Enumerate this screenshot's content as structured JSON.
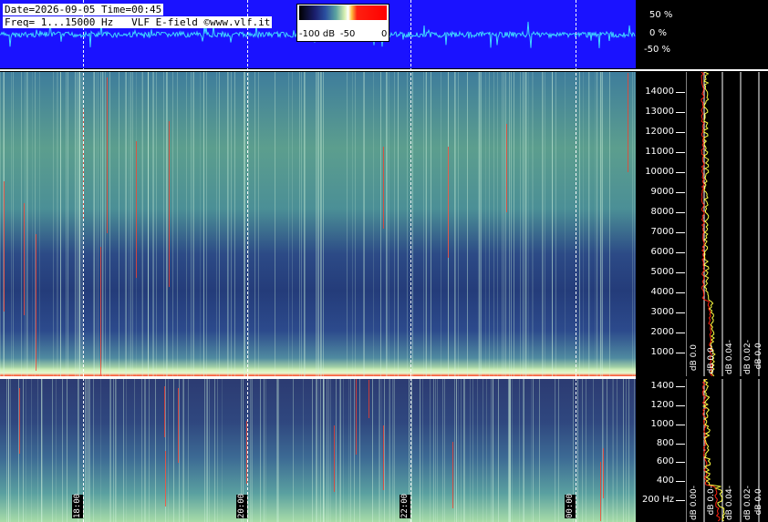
{
  "header": {
    "date_line": "Date=2026-09-05 Time=00:45",
    "freq_line": "Freq= 1...15000 Hz   VLF E-field ©www.vlf.it"
  },
  "colorbar": {
    "label_min": "-100 dB",
    "label_mid": "-50",
    "label_max": "0"
  },
  "amplitude_scale": [
    "50 %",
    "0 %",
    "-50 %"
  ],
  "freq_scale_high": [
    "14000",
    "13000",
    "12000",
    "11000",
    "10000",
    "9000",
    "8000",
    "7000",
    "6000",
    "5000",
    "4000",
    "3000",
    "2000",
    "1000"
  ],
  "freq_scale_low": [
    "1400",
    "1200",
    "1000",
    "800",
    "600",
    "400",
    "200 Hz"
  ],
  "time_labels": [
    "18:00",
    "20:00",
    "22:00",
    "00:00"
  ],
  "spectrum_db_labels_high": [
    "dB 0.0",
    "dB 0.0-",
    "dB 0.04-",
    "dB 0.02-",
    "dB 0.0-"
  ],
  "spectrum_db_labels_low": [
    "dB 0.00-",
    "dB 0.0-",
    "dB 0.04-",
    "dB 0.02-",
    "dB 0.0-"
  ],
  "colors": {
    "waveform_bg": "#1a12ff",
    "waveform_trace": "#40d8ff",
    "spectrum_trace_yellow": "#ffff40",
    "spectrum_trace_red": "#ff2010",
    "grid": "#ffffff"
  }
}
